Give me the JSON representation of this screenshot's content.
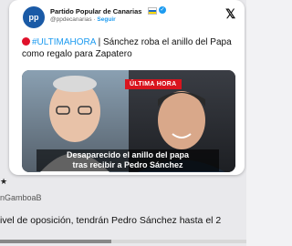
{
  "account": {
    "name": "Partido Popular de Canarias",
    "handle": "@ppdecanarias",
    "separator": " · ",
    "follow_label": "Seguir",
    "avatar_text": "pp",
    "icons": [
      "flag-icon",
      "verified-icon",
      "x-logo-icon"
    ]
  },
  "tweet": {
    "hashtag": "#ULTIMAHORA",
    "body": " | Sánchez roba el anillo del Papa como regalo para Zapatero"
  },
  "media": {
    "breaking_label": "ÚLTIMA HORA",
    "caption_line1": "Desaparecido el anillo del papa",
    "caption_line2": "tras recibir a Pedro Sánchez"
  },
  "background": {
    "user_name_fragment": "★",
    "user_handle_fragment": "nGamboaB",
    "reply_text": "ivel de oposición, tendrán Pedro Sánchez hasta el 2"
  },
  "progress": {
    "value": 0.45
  },
  "colors": {
    "verified": "#1d9bf0",
    "breaking": "#d9141e",
    "avatar": "#1a5aa6"
  }
}
